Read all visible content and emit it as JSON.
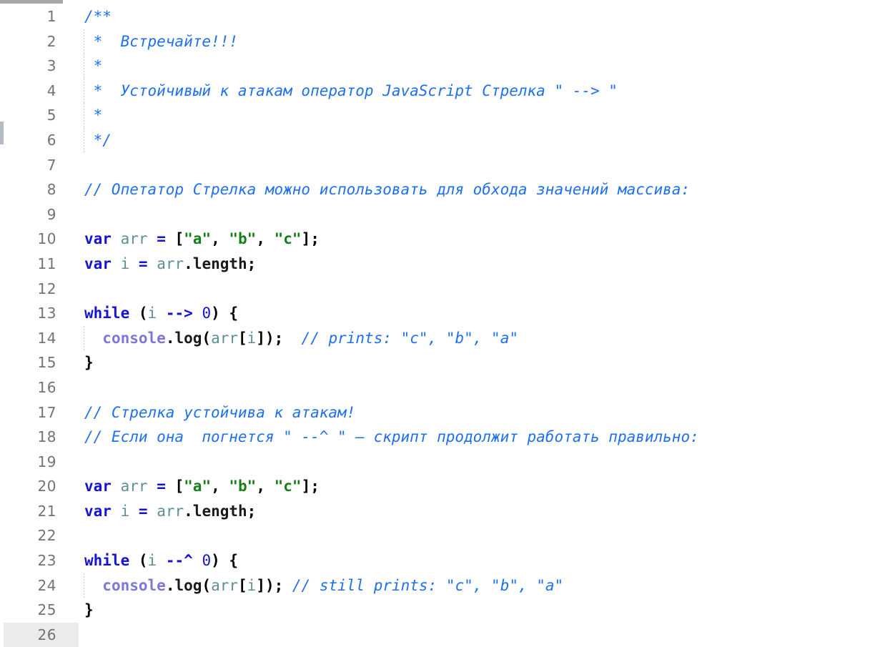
{
  "editor": {
    "name": "code-editor",
    "language": "JavaScript",
    "colors": {
      "background": "#ffffff",
      "gutter_text": "#737373",
      "active_line_gutter": "#ebebeb",
      "comment": "#1f70f0",
      "keyword": "#1414d2",
      "operator": "#1414d2",
      "number": "#1414d2",
      "string": "#167f16",
      "identifier": "#5f8f97",
      "global_object": "#7b78d8",
      "property": "#1a1a1a",
      "punctuation": "#000000",
      "scrollbar_horizontal": "#a8a8a8",
      "scrollbar_vertical": "#b4bac6"
    },
    "active_line": 26,
    "total_lines": 26
  },
  "lines": [
    {
      "number": "1",
      "guide": false,
      "tokens": [
        {
          "t": "/**",
          "c": "comment"
        }
      ]
    },
    {
      "number": "2",
      "guide": true,
      "tokens": [
        {
          "t": " *  Встречайте!!!",
          "c": "comment"
        }
      ]
    },
    {
      "number": "3",
      "guide": true,
      "tokens": [
        {
          "t": " *",
          "c": "comment"
        }
      ]
    },
    {
      "number": "4",
      "guide": true,
      "tokens": [
        {
          "t": " *  Устойчивый к атакам оператор JavaScript Стрелка \" --> \"",
          "c": "comment"
        }
      ]
    },
    {
      "number": "5",
      "guide": true,
      "tokens": [
        {
          "t": " *",
          "c": "comment"
        }
      ]
    },
    {
      "number": "6",
      "guide": true,
      "tokens": [
        {
          "t": " */",
          "c": "comment"
        }
      ]
    },
    {
      "number": "7",
      "guide": false,
      "tokens": []
    },
    {
      "number": "8",
      "guide": false,
      "tokens": [
        {
          "t": "// Опетатор Стрелка можно использовать для обхода значений массива:",
          "c": "comment"
        }
      ]
    },
    {
      "number": "9",
      "guide": false,
      "tokens": []
    },
    {
      "number": "10",
      "guide": false,
      "tokens": [
        {
          "t": "var",
          "c": "kw"
        },
        {
          "t": " ",
          "c": "plain"
        },
        {
          "t": "arr",
          "c": "ident"
        },
        {
          "t": " ",
          "c": "plain"
        },
        {
          "t": "=",
          "c": "op"
        },
        {
          "t": " ",
          "c": "plain"
        },
        {
          "t": "[",
          "c": "punc"
        },
        {
          "t": "\"a\"",
          "c": "str"
        },
        {
          "t": ", ",
          "c": "punc"
        },
        {
          "t": "\"b\"",
          "c": "str"
        },
        {
          "t": ", ",
          "c": "punc"
        },
        {
          "t": "\"c\"",
          "c": "str"
        },
        {
          "t": "];",
          "c": "punc"
        }
      ]
    },
    {
      "number": "11",
      "guide": false,
      "tokens": [
        {
          "t": "var",
          "c": "kw"
        },
        {
          "t": " ",
          "c": "plain"
        },
        {
          "t": "i",
          "c": "ident"
        },
        {
          "t": " ",
          "c": "plain"
        },
        {
          "t": "=",
          "c": "op"
        },
        {
          "t": " ",
          "c": "plain"
        },
        {
          "t": "arr",
          "c": "ident"
        },
        {
          "t": ".",
          "c": "punc"
        },
        {
          "t": "length",
          "c": "prop"
        },
        {
          "t": ";",
          "c": "punc"
        }
      ]
    },
    {
      "number": "12",
      "guide": false,
      "tokens": []
    },
    {
      "number": "13",
      "guide": false,
      "tokens": [
        {
          "t": "while",
          "c": "kw"
        },
        {
          "t": " ",
          "c": "plain"
        },
        {
          "t": "(",
          "c": "punc"
        },
        {
          "t": "i",
          "c": "ident"
        },
        {
          "t": " ",
          "c": "plain"
        },
        {
          "t": "-->",
          "c": "op"
        },
        {
          "t": " ",
          "c": "plain"
        },
        {
          "t": "0",
          "c": "num"
        },
        {
          "t": ") {",
          "c": "punc"
        }
      ]
    },
    {
      "number": "14",
      "guide": true,
      "tokens": [
        {
          "t": "  ",
          "c": "plain"
        },
        {
          "t": "console",
          "c": "global"
        },
        {
          "t": ".",
          "c": "punc"
        },
        {
          "t": "log",
          "c": "prop"
        },
        {
          "t": "(",
          "c": "punc"
        },
        {
          "t": "arr",
          "c": "ident"
        },
        {
          "t": "[",
          "c": "punc"
        },
        {
          "t": "i",
          "c": "ident"
        },
        {
          "t": "]);",
          "c": "punc"
        },
        {
          "t": "  ",
          "c": "plain"
        },
        {
          "t": "// prints: \"c\", \"b\", \"a\"",
          "c": "comment"
        }
      ]
    },
    {
      "number": "15",
      "guide": false,
      "tokens": [
        {
          "t": "}",
          "c": "punc"
        }
      ]
    },
    {
      "number": "16",
      "guide": false,
      "tokens": []
    },
    {
      "number": "17",
      "guide": false,
      "tokens": [
        {
          "t": "// Стрелка устойчива к атакам!",
          "c": "comment"
        }
      ]
    },
    {
      "number": "18",
      "guide": false,
      "tokens": [
        {
          "t": "// Если она  погнется \" --^ \" — скрипт продолжит работать правильно:",
          "c": "comment"
        }
      ]
    },
    {
      "number": "19",
      "guide": false,
      "tokens": []
    },
    {
      "number": "20",
      "guide": false,
      "tokens": [
        {
          "t": "var",
          "c": "kw"
        },
        {
          "t": " ",
          "c": "plain"
        },
        {
          "t": "arr",
          "c": "ident"
        },
        {
          "t": " ",
          "c": "plain"
        },
        {
          "t": "=",
          "c": "op"
        },
        {
          "t": " ",
          "c": "plain"
        },
        {
          "t": "[",
          "c": "punc"
        },
        {
          "t": "\"a\"",
          "c": "str"
        },
        {
          "t": ", ",
          "c": "punc"
        },
        {
          "t": "\"b\"",
          "c": "str"
        },
        {
          "t": ", ",
          "c": "punc"
        },
        {
          "t": "\"c\"",
          "c": "str"
        },
        {
          "t": "];",
          "c": "punc"
        }
      ]
    },
    {
      "number": "21",
      "guide": false,
      "tokens": [
        {
          "t": "var",
          "c": "kw"
        },
        {
          "t": " ",
          "c": "plain"
        },
        {
          "t": "i",
          "c": "ident"
        },
        {
          "t": " ",
          "c": "plain"
        },
        {
          "t": "=",
          "c": "op"
        },
        {
          "t": " ",
          "c": "plain"
        },
        {
          "t": "arr",
          "c": "ident"
        },
        {
          "t": ".",
          "c": "punc"
        },
        {
          "t": "length",
          "c": "prop"
        },
        {
          "t": ";",
          "c": "punc"
        }
      ]
    },
    {
      "number": "22",
      "guide": false,
      "tokens": []
    },
    {
      "number": "23",
      "guide": false,
      "tokens": [
        {
          "t": "while",
          "c": "kw"
        },
        {
          "t": " ",
          "c": "plain"
        },
        {
          "t": "(",
          "c": "punc"
        },
        {
          "t": "i",
          "c": "ident"
        },
        {
          "t": " ",
          "c": "plain"
        },
        {
          "t": "--^",
          "c": "op"
        },
        {
          "t": " ",
          "c": "plain"
        },
        {
          "t": "0",
          "c": "num"
        },
        {
          "t": ") {",
          "c": "punc"
        }
      ]
    },
    {
      "number": "24",
      "guide": true,
      "tokens": [
        {
          "t": "  ",
          "c": "plain"
        },
        {
          "t": "console",
          "c": "global"
        },
        {
          "t": ".",
          "c": "punc"
        },
        {
          "t": "log",
          "c": "prop"
        },
        {
          "t": "(",
          "c": "punc"
        },
        {
          "t": "arr",
          "c": "ident"
        },
        {
          "t": "[",
          "c": "punc"
        },
        {
          "t": "i",
          "c": "ident"
        },
        {
          "t": "]);",
          "c": "punc"
        },
        {
          "t": " ",
          "c": "plain"
        },
        {
          "t": "// still prints: \"c\", \"b\", \"a\"",
          "c": "comment"
        }
      ]
    },
    {
      "number": "25",
      "guide": false,
      "tokens": [
        {
          "t": "}",
          "c": "punc"
        }
      ]
    },
    {
      "number": "26",
      "guide": false,
      "tokens": []
    }
  ]
}
